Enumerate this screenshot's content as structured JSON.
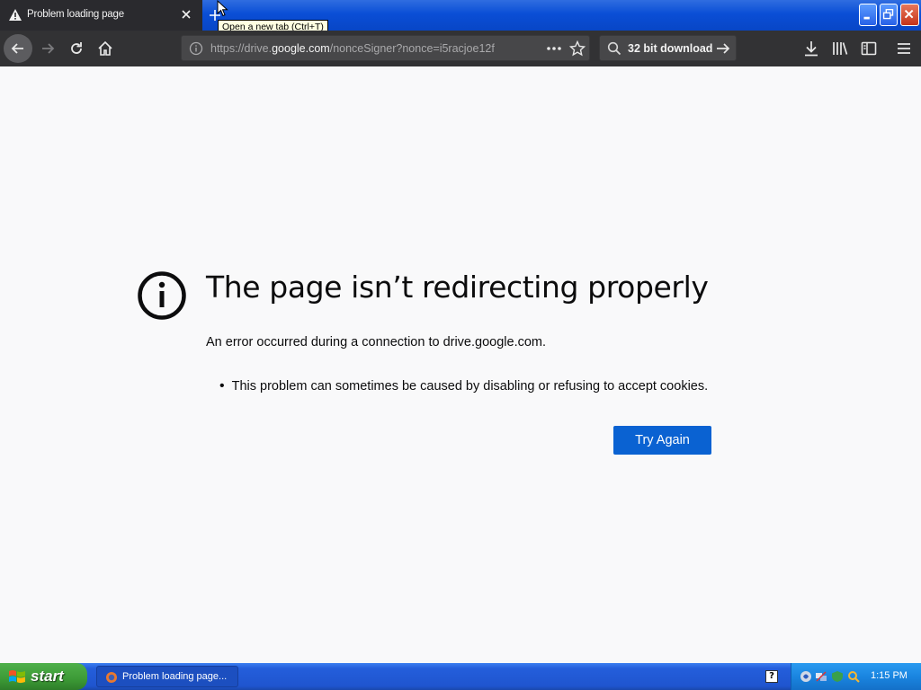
{
  "browser": {
    "tab": {
      "title": "Problem loading page"
    },
    "tooltip": "Open a new tab (Ctrl+T)",
    "url": {
      "prefix": "https://drive.",
      "domain": "google.com",
      "path": "/nonceSigner?nonce=i5racjoe12f"
    },
    "search": {
      "value": "32 bit download"
    }
  },
  "error_page": {
    "title": "The page isn’t redirecting properly",
    "description": "An error occurred during a connection to drive.google.com.",
    "bullets": [
      "This problem can sometimes be caused by disabling or refusing to accept cookies."
    ],
    "button_label": "Try Again"
  },
  "taskbar": {
    "start_label": "start",
    "task_item": "Problem loading page...",
    "help_label": "?",
    "clock": "1:15 PM"
  },
  "colors": {
    "accent": "#0a62d2",
    "toolbar": "#323234",
    "content_bg": "#f9f9fa",
    "taskbar": "#245edb",
    "start_green": "#3c9a36"
  }
}
